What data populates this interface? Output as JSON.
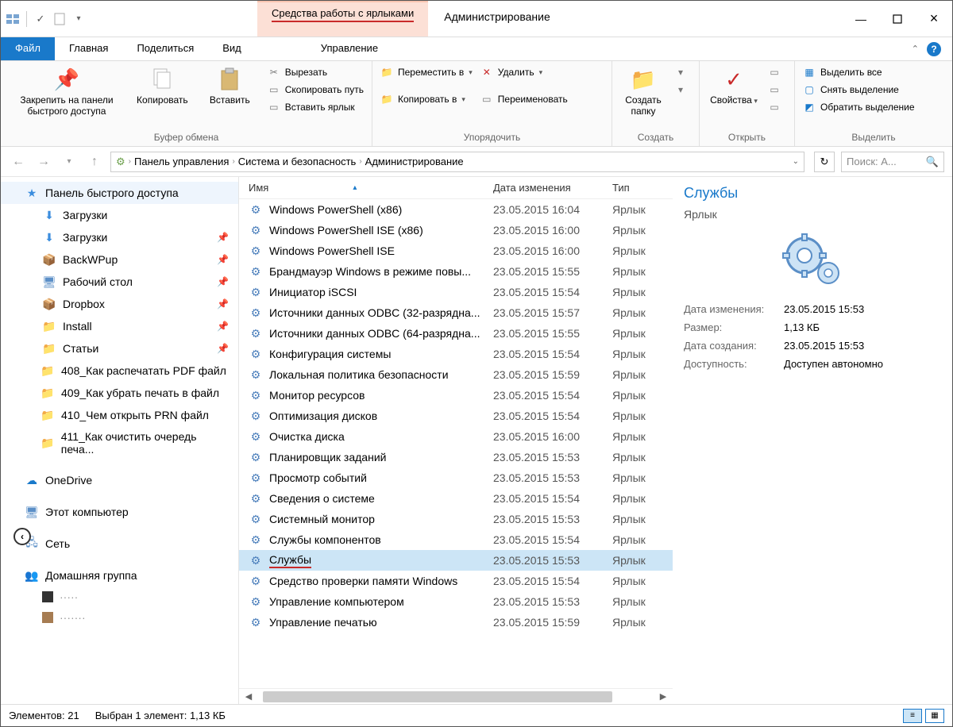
{
  "titlebar": {
    "context_tab": "Средства работы с ярлыками",
    "window_title": "Администрирование"
  },
  "ribbon_tabs": {
    "file": "Файл",
    "home": "Главная",
    "share": "Поделиться",
    "view": "Вид",
    "manage": "Управление"
  },
  "ribbon": {
    "clipboard": {
      "pin": "Закрепить на панели быстрого доступа",
      "copy": "Копировать",
      "paste": "Вставить",
      "cut": "Вырезать",
      "copy_path": "Скопировать путь",
      "paste_shortcut": "Вставить ярлык",
      "title": "Буфер обмена"
    },
    "organize": {
      "move_to": "Переместить в",
      "copy_to": "Копировать в",
      "delete": "Удалить",
      "rename": "Переименовать",
      "title": "Упорядочить"
    },
    "create": {
      "new_folder": "Создать папку",
      "title": "Создать"
    },
    "open": {
      "properties": "Свойства",
      "title": "Открыть"
    },
    "select": {
      "select_all": "Выделить все",
      "select_none": "Снять выделение",
      "invert": "Обратить выделение",
      "title": "Выделить"
    }
  },
  "breadcrumb": {
    "items": [
      "Панель управления",
      "Система и безопасность",
      "Администрирование"
    ]
  },
  "search": {
    "placeholder": "Поиск: А..."
  },
  "nav": {
    "quick_access": "Панель быстрого доступа",
    "items": [
      {
        "label": "Загрузки",
        "pin": false
      },
      {
        "label": "Загрузки",
        "pin": true
      },
      {
        "label": "BackWPup",
        "pin": true
      },
      {
        "label": "Рабочий стол",
        "pin": true
      },
      {
        "label": "Dropbox",
        "pin": true
      },
      {
        "label": "Install",
        "pin": true
      },
      {
        "label": "Статьи",
        "pin": true
      },
      {
        "label": "408_Как распечатать PDF файл"
      },
      {
        "label": "409_Как убрать печать в файл"
      },
      {
        "label": "410_Чем открыть PRN файл"
      },
      {
        "label": "411_Как очистить очередь печа..."
      }
    ],
    "onedrive": "OneDrive",
    "this_pc": "Этот компьютер",
    "network": "Сеть",
    "homegroup": "Домашняя группа"
  },
  "columns": {
    "name": "Имя",
    "date": "Дата изменения",
    "type": "Тип"
  },
  "files": [
    {
      "name": "Windows PowerShell (x86)",
      "date": "23.05.2015 16:04",
      "type": "Ярлык"
    },
    {
      "name": "Windows PowerShell ISE (x86)",
      "date": "23.05.2015 16:00",
      "type": "Ярлык"
    },
    {
      "name": "Windows PowerShell ISE",
      "date": "23.05.2015 16:00",
      "type": "Ярлык"
    },
    {
      "name": "Брандмауэр Windows в режиме повы...",
      "date": "23.05.2015 15:55",
      "type": "Ярлык"
    },
    {
      "name": "Инициатор iSCSI",
      "date": "23.05.2015 15:54",
      "type": "Ярлык"
    },
    {
      "name": "Источники данных ODBC (32-разрядна...",
      "date": "23.05.2015 15:57",
      "type": "Ярлык"
    },
    {
      "name": "Источники данных ODBC (64-разрядна...",
      "date": "23.05.2015 15:55",
      "type": "Ярлык"
    },
    {
      "name": "Конфигурация системы",
      "date": "23.05.2015 15:54",
      "type": "Ярлык"
    },
    {
      "name": "Локальная политика безопасности",
      "date": "23.05.2015 15:59",
      "type": "Ярлык"
    },
    {
      "name": "Монитор ресурсов",
      "date": "23.05.2015 15:54",
      "type": "Ярлык"
    },
    {
      "name": "Оптимизация дисков",
      "date": "23.05.2015 15:54",
      "type": "Ярлык"
    },
    {
      "name": "Очистка диска",
      "date": "23.05.2015 16:00",
      "type": "Ярлык"
    },
    {
      "name": "Планировщик заданий",
      "date": "23.05.2015 15:53",
      "type": "Ярлык"
    },
    {
      "name": "Просмотр событий",
      "date": "23.05.2015 15:53",
      "type": "Ярлык"
    },
    {
      "name": "Сведения о системе",
      "date": "23.05.2015 15:54",
      "type": "Ярлык"
    },
    {
      "name": "Системный монитор",
      "date": "23.05.2015 15:53",
      "type": "Ярлык"
    },
    {
      "name": "Службы компонентов",
      "date": "23.05.2015 15:54",
      "type": "Ярлык"
    },
    {
      "name": "Службы",
      "date": "23.05.2015 15:53",
      "type": "Ярлык",
      "selected": true,
      "underline": true
    },
    {
      "name": "Средство проверки памяти Windows",
      "date": "23.05.2015 15:54",
      "type": "Ярлык"
    },
    {
      "name": "Управление компьютером",
      "date": "23.05.2015 15:53",
      "type": "Ярлык"
    },
    {
      "name": "Управление печатью",
      "date": "23.05.2015 15:59",
      "type": "Ярлык"
    }
  ],
  "preview": {
    "title": "Службы",
    "type": "Ярлык",
    "meta": {
      "date_mod_label": "Дата изменения:",
      "date_mod": "23.05.2015 15:53",
      "size_label": "Размер:",
      "size": "1,13 КБ",
      "date_created_label": "Дата создания:",
      "date_created": "23.05.2015 15:53",
      "avail_label": "Доступность:",
      "avail": "Доступен автономно"
    }
  },
  "status": {
    "count": "Элементов: 21",
    "selection": "Выбран 1 элемент: 1,13 КБ"
  }
}
